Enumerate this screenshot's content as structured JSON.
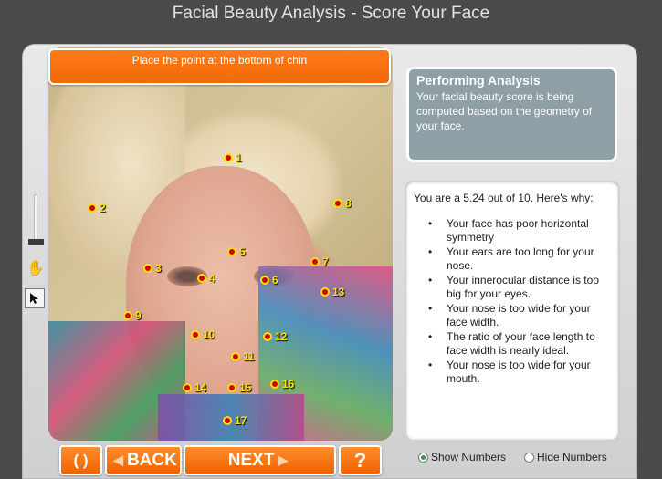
{
  "app": {
    "title": "Facial Beauty Analysis - Score Your Face"
  },
  "instruction": "Place the point at the bottom of chin",
  "points": [
    {
      "label": "1"
    },
    {
      "label": "2"
    },
    {
      "label": "3"
    },
    {
      "label": "4"
    },
    {
      "label": "5"
    },
    {
      "label": "6"
    },
    {
      "label": "7"
    },
    {
      "label": "8"
    },
    {
      "label": "9"
    },
    {
      "label": "10"
    },
    {
      "label": "11"
    },
    {
      "label": "12"
    },
    {
      "label": "13"
    },
    {
      "label": "14"
    },
    {
      "label": "15"
    },
    {
      "label": "16"
    },
    {
      "label": "17"
    }
  ],
  "analysis_panel": {
    "title": "Performing Analysis",
    "body": "Your facial beauty score is being computed based on the geometry of your face."
  },
  "results": {
    "score_text": "You are a 5.24 out of 10.  Here's why:",
    "items": [
      "Your face has poor horizontal symmetry",
      "Your ears are too long for your nose.",
      "Your innerocular distance is too big for your eyes.",
      "Your nose is too wide for your face width.",
      "The ratio of your face length to face width is nearly ideal.",
      "Your nose is too wide for your mouth."
    ]
  },
  "buttons": {
    "reset_label": "( )",
    "back_label": "BACK",
    "next_label": "NEXT",
    "help_label": "?"
  },
  "options": {
    "show_numbers": "Show Numbers",
    "hide_numbers": "Hide Numbers",
    "selected": "show_numbers"
  },
  "colors": {
    "accent": "#f26a06",
    "point_fill": "#d40000",
    "point_ring": "#ffe000",
    "panel_gray": "#8e9fa6"
  }
}
